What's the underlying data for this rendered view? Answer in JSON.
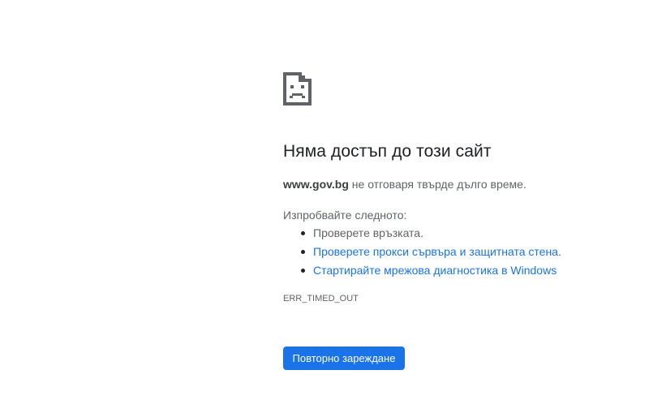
{
  "error_page": {
    "icon": "sad-page-icon",
    "title": "Няма достъп до този сайт",
    "summary": {
      "host": "www.gov.bg",
      "message": " не отговаря твърде дълго време."
    },
    "try_heading": "Изпробвайте следното:",
    "suggestions": [
      {
        "text": "Проверете връзката",
        "suffix": ".",
        "is_link": false
      },
      {
        "text": "Проверете прокси сървъра и защитната стена",
        "suffix": ".",
        "is_link": true
      },
      {
        "text": "Стартирайте мрежова диагностика в Windows",
        "suffix": "",
        "is_link": true
      }
    ],
    "error_code": "ERR_TIMED_OUT",
    "reload_label": "Повторно зареждане",
    "colors": {
      "accent": "#1a73e8",
      "text": "#202124",
      "secondary_text": "#5f6368"
    }
  }
}
